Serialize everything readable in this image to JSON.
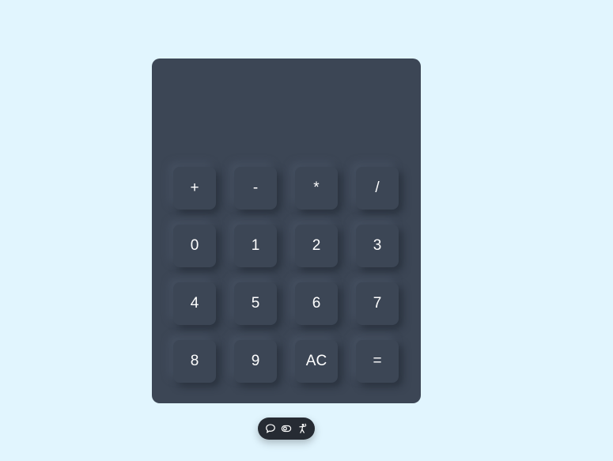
{
  "display": {
    "value": ""
  },
  "keys": {
    "plus": "+",
    "minus": "-",
    "multiply": "*",
    "divide": "/",
    "d0": "0",
    "d1": "1",
    "d2": "2",
    "d3": "3",
    "d4": "4",
    "d5": "5",
    "d6": "6",
    "d7": "7",
    "d8": "8",
    "d9": "9",
    "clear": "AC",
    "equals": "="
  },
  "toolbar": {
    "icons": [
      "comment-icon",
      "eye-icon",
      "accessibility-icon"
    ]
  },
  "colors": {
    "page_background": "#e1f5fe",
    "calculator_background": "#3c4655",
    "key_text": "#ffffff",
    "toolbar_background": "#262b33"
  }
}
